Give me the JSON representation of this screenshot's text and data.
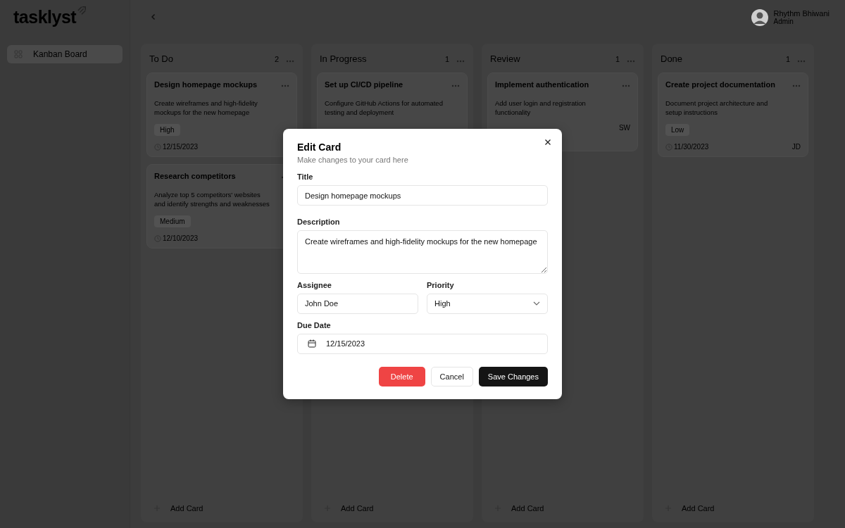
{
  "sidebar": {
    "logo": "tasklyst",
    "items": [
      {
        "label": "Kanban Board",
        "selected": true
      }
    ]
  },
  "header": {
    "user": {
      "name": "Rhythm Bhiwani",
      "role": "Admin"
    }
  },
  "columns": [
    {
      "title": "To Do",
      "count": "2",
      "add_label": "Add Card",
      "cards": [
        {
          "title": "Design homepage mockups",
          "description": "Create wireframes and high-fidelity mockups for the new homepage",
          "priority": "High",
          "due": "12/15/2023"
        },
        {
          "title": "Research competitors",
          "description": "Analyze top 5 competitors' websites and identify strengths and weaknesses",
          "priority": "Medium",
          "due": "12/10/2023"
        }
      ]
    },
    {
      "title": "In Progress",
      "count": "1",
      "add_label": "Add Card",
      "cards": [
        {
          "title": "Set up CI/CD pipeline",
          "description": "Configure GitHub Actions for automated testing and deployment"
        }
      ]
    },
    {
      "title": "Review",
      "count": "1",
      "add_label": "Add Card",
      "cards": [
        {
          "title": "Implement authentication",
          "description": "Add user login and registration functionality",
          "assignee": "SW"
        }
      ]
    },
    {
      "title": "Done",
      "count": "1",
      "add_label": "Add Card",
      "cards": [
        {
          "title": "Create project documentation",
          "description": "Document project architecture and setup instructions",
          "priority": "Low",
          "due": "11/30/2023",
          "assignee": "JD"
        }
      ]
    }
  ],
  "modal": {
    "title": "Edit Card",
    "subtitle": "Make changes to your card here",
    "title_field": {
      "label": "Title",
      "value": "Design homepage mockups"
    },
    "description_field": {
      "label": "Description",
      "value": "Create wireframes and high-fidelity mockups for the new homepage"
    },
    "assignee_field": {
      "label": "Assignee",
      "value": "John Doe"
    },
    "priority_field": {
      "label": "Priority",
      "value": "High"
    },
    "due_field": {
      "label": "Due Date",
      "value": "12/15/2023"
    },
    "buttons": [
      {
        "label": "Delete",
        "kind": "danger"
      },
      {
        "label": "Cancel",
        "kind": "outline"
      },
      {
        "label": "Save Changes",
        "kind": "primary"
      }
    ]
  }
}
